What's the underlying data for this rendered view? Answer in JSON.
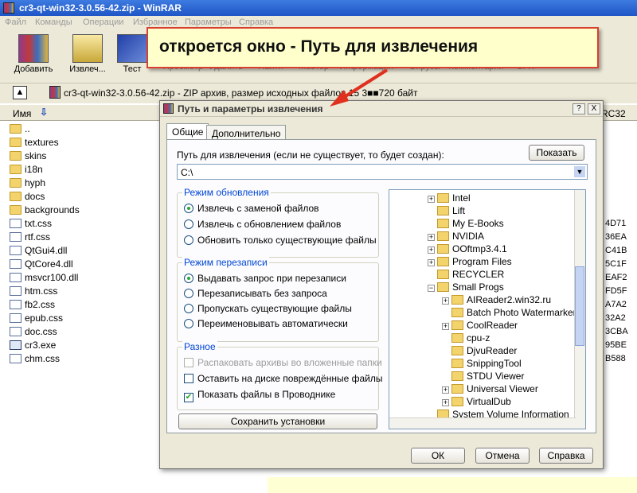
{
  "window": {
    "title": "cr3-qt-win32-3.0.56-42.zip - WinRAR"
  },
  "menu": [
    "Файл",
    "Команды",
    "Операции",
    "Избранное",
    "Параметры",
    "Справка"
  ],
  "toolbar": [
    {
      "label": "Добавить",
      "icon": "add-archive-icon",
      "faded": false
    },
    {
      "label": "Извлеч...",
      "icon": "extract-icon",
      "faded": false
    },
    {
      "label": "Тест",
      "icon": "test-icon",
      "faded": false
    },
    {
      "label": "Просмотр",
      "icon": "view-icon",
      "faded": true
    },
    {
      "label": "Удалить",
      "icon": "delete-icon",
      "faded": true
    },
    {
      "label": "Найти",
      "icon": "find-icon",
      "faded": true
    },
    {
      "label": "Мастер",
      "icon": "wizard-icon",
      "faded": true
    },
    {
      "label": "Информация",
      "icon": "info-icon",
      "faded": true
    },
    {
      "label": "Вирусы",
      "icon": "virus-icon",
      "faded": true
    },
    {
      "label": "Комментарии",
      "icon": "comment-icon",
      "faded": true
    },
    {
      "label": "SFX",
      "icon": "sfx-icon",
      "faded": true
    }
  ],
  "address": "cr3-qt-win32-3.0.56-42.zip - ZIP архив, размер исходных файлов 15 3■■720 байт",
  "columns": {
    "name": "Имя",
    "crc": "RC32"
  },
  "files": [
    {
      "name": "..",
      "type": "folder",
      "crc": ""
    },
    {
      "name": "textures",
      "type": "folder",
      "crc": ""
    },
    {
      "name": "skins",
      "type": "folder",
      "crc": ""
    },
    {
      "name": "i18n",
      "type": "folder",
      "crc": ""
    },
    {
      "name": "hyph",
      "type": "folder",
      "crc": ""
    },
    {
      "name": "docs",
      "type": "folder",
      "crc": ""
    },
    {
      "name": "backgrounds",
      "type": "folder",
      "crc": ""
    },
    {
      "name": "txt.css",
      "type": "file",
      "crc": "4D71"
    },
    {
      "name": "rtf.css",
      "type": "file",
      "crc": "36EA"
    },
    {
      "name": "QtGui4.dll",
      "type": "file",
      "crc": "C41B"
    },
    {
      "name": "QtCore4.dll",
      "type": "file",
      "crc": "5C1F"
    },
    {
      "name": "msvcr100.dll",
      "type": "file",
      "crc": "EAF2"
    },
    {
      "name": "htm.css",
      "type": "file",
      "crc": "FD5F"
    },
    {
      "name": "fb2.css",
      "type": "file",
      "crc": "A7A2"
    },
    {
      "name": "epub.css",
      "type": "file",
      "crc": "32A2"
    },
    {
      "name": "doc.css",
      "type": "file",
      "crc": "3CBA"
    },
    {
      "name": "cr3.exe",
      "type": "exe",
      "crc": "95BE"
    },
    {
      "name": "chm.css",
      "type": "file",
      "crc": "B588"
    }
  ],
  "callout": {
    "text": "откроется окно - Путь для извлечения"
  },
  "dialog": {
    "title": "Путь и параметры извлечения",
    "help_btn": "?",
    "close_btn": "X",
    "tabs": [
      "Общие",
      "Дополнительно"
    ],
    "path_label": "Путь для извлечения (если не существует, то будет создан):",
    "show_btn": "Показать",
    "path_value": "C:\\",
    "update_mode": {
      "title": "Режим обновления",
      "options": [
        {
          "label": "Извлечь с заменой файлов",
          "selected": true
        },
        {
          "label": "Извлечь с обновлением файлов",
          "selected": false
        },
        {
          "label": "Обновить только существующие файлы",
          "selected": false
        }
      ]
    },
    "overwrite_mode": {
      "title": "Режим перезаписи",
      "options": [
        {
          "label": "Выдавать запрос при перезаписи",
          "selected": true
        },
        {
          "label": "Перезаписывать без запроса",
          "selected": false
        },
        {
          "label": "Пропускать существующие файлы",
          "selected": false
        },
        {
          "label": "Переименовывать автоматически",
          "selected": false
        }
      ]
    },
    "misc": {
      "title": "Разное",
      "options": [
        {
          "label": "Распаковать архивы во вложенные папки",
          "checked": false,
          "disabled": true
        },
        {
          "label": "Оставить на диске повреждённые файлы",
          "checked": false,
          "disabled": false
        },
        {
          "label": "Показать файлы в Проводнике",
          "checked": true,
          "disabled": false
        }
      ]
    },
    "save_btn": "Сохранить установки",
    "tree": [
      {
        "label": "Intel",
        "level": 0,
        "expand": "+"
      },
      {
        "label": "Lift",
        "level": 0,
        "expand": ""
      },
      {
        "label": "My E-Books",
        "level": 0,
        "expand": ""
      },
      {
        "label": "NVIDIA",
        "level": 0,
        "expand": "+"
      },
      {
        "label": "OOftmp3.4.1",
        "level": 0,
        "expand": "+"
      },
      {
        "label": "Program Files",
        "level": 0,
        "expand": "+"
      },
      {
        "label": "RECYCLER",
        "level": 0,
        "expand": ""
      },
      {
        "label": "Small Progs",
        "level": 0,
        "expand": "-"
      },
      {
        "label": "AIReader2.win32.ru",
        "level": 1,
        "expand": "+"
      },
      {
        "label": "Batch Photo Watermarker",
        "level": 1,
        "expand": ""
      },
      {
        "label": "CoolReader",
        "level": 1,
        "expand": "+"
      },
      {
        "label": "cpu-z",
        "level": 1,
        "expand": ""
      },
      {
        "label": "DjvuReader",
        "level": 1,
        "expand": ""
      },
      {
        "label": "SnippingTool",
        "level": 1,
        "expand": ""
      },
      {
        "label": "STDU Viewer",
        "level": 1,
        "expand": ""
      },
      {
        "label": "Universal Viewer",
        "level": 1,
        "expand": "+"
      },
      {
        "label": "VirtualDub",
        "level": 1,
        "expand": "+"
      },
      {
        "label": "System Volume Information",
        "level": 0,
        "expand": ""
      }
    ],
    "ok_btn": "ОК",
    "cancel_btn": "Отмена",
    "help_btn_label": "Справка"
  }
}
